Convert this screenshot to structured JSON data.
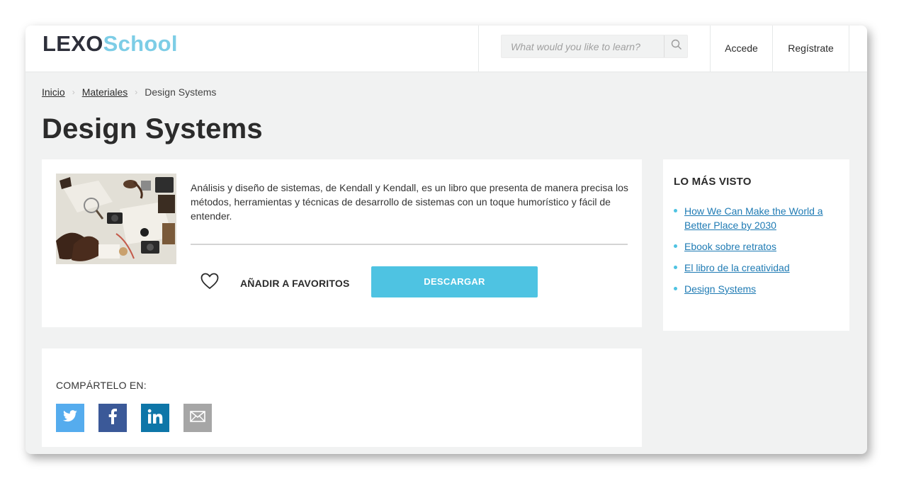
{
  "header": {
    "logo_part1": "LEXO",
    "logo_part2": "School",
    "search_placeholder": "What would you like to learn?",
    "search_icon": "search-icon",
    "login_label": "Accede",
    "register_label": "Regístrate"
  },
  "breadcrumb": {
    "home": "Inicio",
    "section": "Materiales",
    "current": "Design Systems"
  },
  "page": {
    "title": "Design Systems"
  },
  "material": {
    "description": "Análisis y diseño de sistemas, de Kendall y Kendall, es un libro que presenta de manera precisa los métodos, herramientas y técnicas de desarrollo de sistemas con un toque humorístico y fácil de entender.",
    "favorite_label": "AÑADIR A FAVORITOS",
    "favorite_icon": "heart-icon",
    "download_label": "DESCARGAR"
  },
  "share": {
    "label": "COMPÁRTELO EN:",
    "networks": [
      "twitter-icon",
      "facebook-icon",
      "linkedin-icon",
      "mail-icon"
    ]
  },
  "sidebar": {
    "title": "LO MÁS VISTO",
    "items": [
      {
        "label": "How We Can Make the World a Better Place by 2030"
      },
      {
        "label": "Ebook sobre retratos"
      },
      {
        "label": "El libro de la creatividad"
      },
      {
        "label": "Design Systems"
      }
    ]
  },
  "colors": {
    "accent": "#4ec3e2",
    "logo_dark": "#2d2f3a",
    "logo_light": "#7dcde6",
    "twitter": "#55acee",
    "facebook": "#3b5998",
    "linkedin": "#0e76a8",
    "mail": "#a6a6a6",
    "link": "#1f7bb4"
  }
}
